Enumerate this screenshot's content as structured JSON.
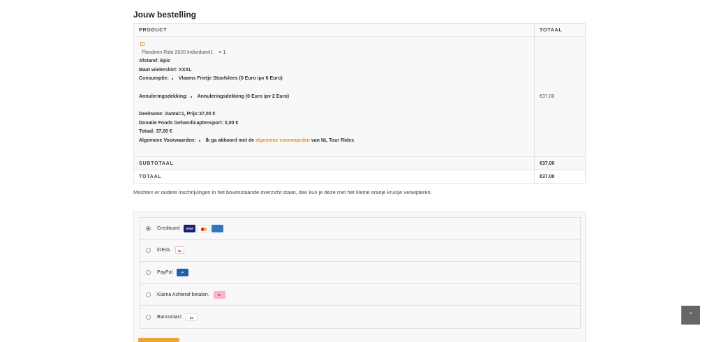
{
  "heading": "Jouw bestelling",
  "table": {
    "col_product": "PRODUCT",
    "col_total": "TOTAAL",
    "remove_icon": "×",
    "product_name": "Flandrien Ride 2020 Individueel1",
    "quantity": "× 1",
    "product_total": "€37.00",
    "lines": {
      "afstand": "Afstand: Epic",
      "maat": "Maat wielershirt: XXXL",
      "consumptie_label": "Consumptie:",
      "consumptie_value": "Vlaams Frietje Stoofvlees (0 Euro ipv 6 Euro)",
      "annulering_label": "Annuleringsdekking:",
      "annulering_value": "Annuleringsdekking (0 Euro ipv 2 Euro)",
      "deelname": "Deelname: Aantal:1, Prijs:37,00 €",
      "donatie": "Donatie Fonds Gehandicaptensport: 0,00 €",
      "totaal": "Totaal: 37,00 €",
      "voorwaarden_label": "Algemene Voorwaarden:",
      "voorwaarden_prefix": "Ik ga akkoord met de",
      "voorwaarden_link": "algemene voorwaarden",
      "voorwaarden_suffix": "van NL Tour Rides"
    },
    "subtotal_label": "SUBTOTAAL",
    "subtotal_value": "€37.00",
    "total_label": "TOTAAL",
    "total_value": "€37.00"
  },
  "note": "Mochten er oudere inschrijvingen in het bovenstaande overzicht staan, dan kun je deze met het kleine oranje kruisje verwijderen.",
  "payment_methods": [
    {
      "label": "Creditcard",
      "selected": true
    },
    {
      "label": "iDEAL",
      "selected": false
    },
    {
      "label": "PayPal",
      "selected": false
    },
    {
      "label": "Klarna Achteraf betalen.",
      "selected": false
    },
    {
      "label": "Bancontact",
      "selected": false
    }
  ],
  "logos": {
    "visa": "VISA",
    "ideal": "iD",
    "paypal": "P",
    "klarna": "K",
    "bancontact": "bc"
  },
  "scroll_top_icon": "⌃"
}
